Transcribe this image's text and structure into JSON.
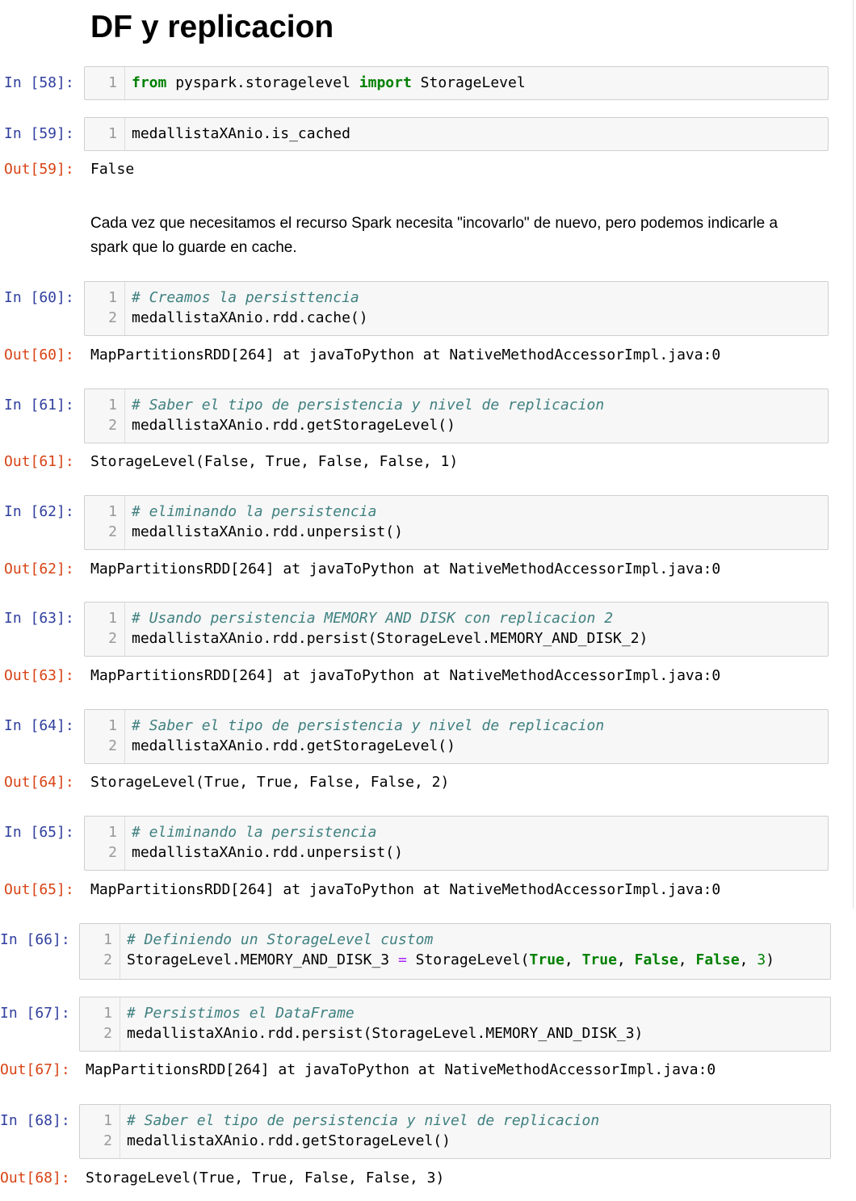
{
  "notebook": {
    "title": "DF y replicacion",
    "markdown_text": "Cada vez que necesitamos el recurso Spark necesita \"incovarlo\" de nuevo, pero podemos indicarle a spark que lo guarde en cache.",
    "cells": [
      {
        "in_prompt": "In [58]:",
        "lines": [
          {
            "num": "1",
            "tokens": [
              {
                "text": "from",
                "cls": "cm-keyword"
              },
              {
                "text": " pyspark.storagelevel ",
                "cls": ""
              },
              {
                "text": "import",
                "cls": "cm-keyword"
              },
              {
                "text": " StorageLevel",
                "cls": ""
              }
            ]
          }
        ],
        "out_prompt": "",
        "output": ""
      },
      {
        "in_prompt": "In [59]:",
        "lines": [
          {
            "num": "1",
            "tokens": [
              {
                "text": "medallistaXAnio.is_cached",
                "cls": ""
              }
            ]
          }
        ],
        "out_prompt": "Out[59]:",
        "output": "False"
      },
      {
        "in_prompt": "In [60]:",
        "lines": [
          {
            "num": "1",
            "tokens": [
              {
                "text": "# Creamos la persisttencia",
                "cls": "cm-comment"
              }
            ]
          },
          {
            "num": "2",
            "tokens": [
              {
                "text": "medallistaXAnio.rdd.cache()",
                "cls": ""
              }
            ]
          }
        ],
        "out_prompt": "Out[60]:",
        "output": "MapPartitionsRDD[264] at javaToPython at NativeMethodAccessorImpl.java:0"
      },
      {
        "in_prompt": "In [61]:",
        "lines": [
          {
            "num": "1",
            "tokens": [
              {
                "text": "# Saber el tipo de persistencia y nivel de replicacion",
                "cls": "cm-comment"
              }
            ]
          },
          {
            "num": "2",
            "tokens": [
              {
                "text": "medallistaXAnio.rdd.getStorageLevel()",
                "cls": ""
              }
            ]
          }
        ],
        "out_prompt": "Out[61]:",
        "output": "StorageLevel(False, True, False, False, 1)"
      },
      {
        "in_prompt": "In [62]:",
        "lines": [
          {
            "num": "1",
            "tokens": [
              {
                "text": "# eliminando la persistencia",
                "cls": "cm-comment"
              }
            ]
          },
          {
            "num": "2",
            "tokens": [
              {
                "text": "medallistaXAnio.rdd.unpersist()",
                "cls": ""
              }
            ]
          }
        ],
        "out_prompt": "Out[62]:",
        "output": "MapPartitionsRDD[264] at javaToPython at NativeMethodAccessorImpl.java:0"
      },
      {
        "in_prompt": "In [63]:",
        "lines": [
          {
            "num": "1",
            "tokens": [
              {
                "text": "# Usando persistencia MEMORY AND DISK con replicacion 2",
                "cls": "cm-comment"
              }
            ]
          },
          {
            "num": "2",
            "tokens": [
              {
                "text": "medallistaXAnio.rdd.persist(StorageLevel.MEMORY_AND_DISK_2)",
                "cls": ""
              }
            ]
          }
        ],
        "out_prompt": "Out[63]:",
        "output": "MapPartitionsRDD[264] at javaToPython at NativeMethodAccessorImpl.java:0"
      },
      {
        "in_prompt": "In [64]:",
        "lines": [
          {
            "num": "1",
            "tokens": [
              {
                "text": "# Saber el tipo de persistencia y nivel de replicacion",
                "cls": "cm-comment"
              }
            ]
          },
          {
            "num": "2",
            "tokens": [
              {
                "text": "medallistaXAnio.rdd.getStorageLevel()",
                "cls": ""
              }
            ]
          }
        ],
        "out_prompt": "Out[64]:",
        "output": "StorageLevel(True, True, False, False, 2)"
      },
      {
        "in_prompt": "In [65]:",
        "lines": [
          {
            "num": "1",
            "tokens": [
              {
                "text": "# eliminando la persistencia",
                "cls": "cm-comment"
              }
            ]
          },
          {
            "num": "2",
            "tokens": [
              {
                "text": "medallistaXAnio.rdd.unpersist()",
                "cls": ""
              }
            ]
          }
        ],
        "out_prompt": "Out[65]:",
        "output": "MapPartitionsRDD[264] at javaToPython at NativeMethodAccessorImpl.java:0"
      },
      {
        "in_prompt": "In [66]:",
        "lines": [
          {
            "num": "1",
            "tokens": [
              {
                "text": "# Definiendo un StorageLevel custom",
                "cls": "cm-comment"
              }
            ]
          },
          {
            "num": "2",
            "tokens": [
              {
                "text": "StorageLevel.MEMORY_AND_DISK_3 ",
                "cls": ""
              },
              {
                "text": "=",
                "cls": "cm-operator"
              },
              {
                "text": " StorageLevel(",
                "cls": ""
              },
              {
                "text": "True",
                "cls": "cm-keyword"
              },
              {
                "text": ", ",
                "cls": ""
              },
              {
                "text": "True",
                "cls": "cm-keyword"
              },
              {
                "text": ", ",
                "cls": ""
              },
              {
                "text": "False",
                "cls": "cm-keyword"
              },
              {
                "text": ", ",
                "cls": ""
              },
              {
                "text": "False",
                "cls": "cm-keyword"
              },
              {
                "text": ", ",
                "cls": ""
              },
              {
                "text": "3",
                "cls": "cm-number"
              },
              {
                "text": ")",
                "cls": ""
              }
            ]
          }
        ],
        "out_prompt": "",
        "output": ""
      },
      {
        "in_prompt": "In [67]:",
        "lines": [
          {
            "num": "1",
            "tokens": [
              {
                "text": "# Persistimos el DataFrame",
                "cls": "cm-comment"
              }
            ]
          },
          {
            "num": "2",
            "tokens": [
              {
                "text": "medallistaXAnio.rdd.persist(StorageLevel.MEMORY_AND_DISK_3)",
                "cls": ""
              }
            ]
          }
        ],
        "out_prompt": "Out[67]:",
        "output": "MapPartitionsRDD[264] at javaToPython at NativeMethodAccessorImpl.java:0"
      },
      {
        "in_prompt": "In [68]:",
        "lines": [
          {
            "num": "1",
            "tokens": [
              {
                "text": "# Saber el tipo de persistencia y nivel de replicacion",
                "cls": "cm-comment"
              }
            ]
          },
          {
            "num": "2",
            "tokens": [
              {
                "text": "medallistaXAnio.rdd.getStorageLevel()",
                "cls": ""
              }
            ]
          }
        ],
        "out_prompt": "Out[68]:",
        "output": "StorageLevel(True, True, False, False, 3)"
      }
    ]
  }
}
